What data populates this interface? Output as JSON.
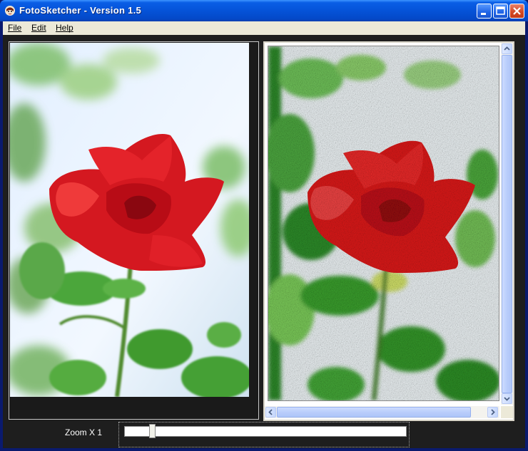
{
  "window": {
    "title": "FotoSketcher - Version 1.5",
    "accent_color": "#0553d8",
    "close_color": "#d44a26"
  },
  "title_buttons": {
    "minimize_icon": "minimize-icon",
    "maximize_icon": "maximize-icon",
    "close_icon": "close-icon"
  },
  "menu": {
    "items": [
      {
        "label": "File"
      },
      {
        "label": "Edit"
      },
      {
        "label": "Help"
      }
    ]
  },
  "panels": {
    "left": {
      "content": "original rose photo"
    },
    "right": {
      "content": "painted rose result"
    }
  },
  "zoom": {
    "label": "Zoom X 1",
    "slider_fraction": 0.1
  }
}
